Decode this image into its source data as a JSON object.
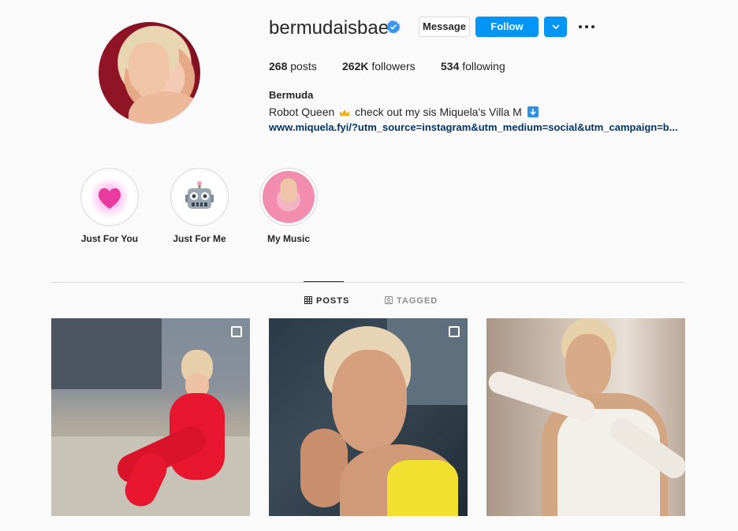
{
  "profile": {
    "username": "bermudaisbae",
    "verified": true,
    "message_label": "Message",
    "follow_label": "Follow",
    "posts_count": "268",
    "posts_label": "posts",
    "followers_count": "262K",
    "followers_label": "followers",
    "following_count": "534",
    "following_label": "following",
    "full_name": "Bermuda",
    "bio_part1": "Robot Queen",
    "bio_part2": "check out my sis Miquela's Villa M",
    "link": "www.miquela.fyi/?utm_source=instagram&utm_medium=social&utm_campaign=b..."
  },
  "highlights": [
    {
      "label": "Just For You",
      "icon": "pink-heart-icon"
    },
    {
      "label": "Just For Me",
      "icon": "robot-face-icon"
    },
    {
      "label": "My Music",
      "icon": "photo-thumbnail"
    }
  ],
  "tabs": {
    "posts": "POSTS",
    "tagged": "TAGGED",
    "active": "posts"
  },
  "colors": {
    "accent": "#0095f6",
    "link": "#00376b",
    "verified": "#3897f0",
    "text": "#262626",
    "muted": "#8e8e8e",
    "background": "#fafafa"
  }
}
